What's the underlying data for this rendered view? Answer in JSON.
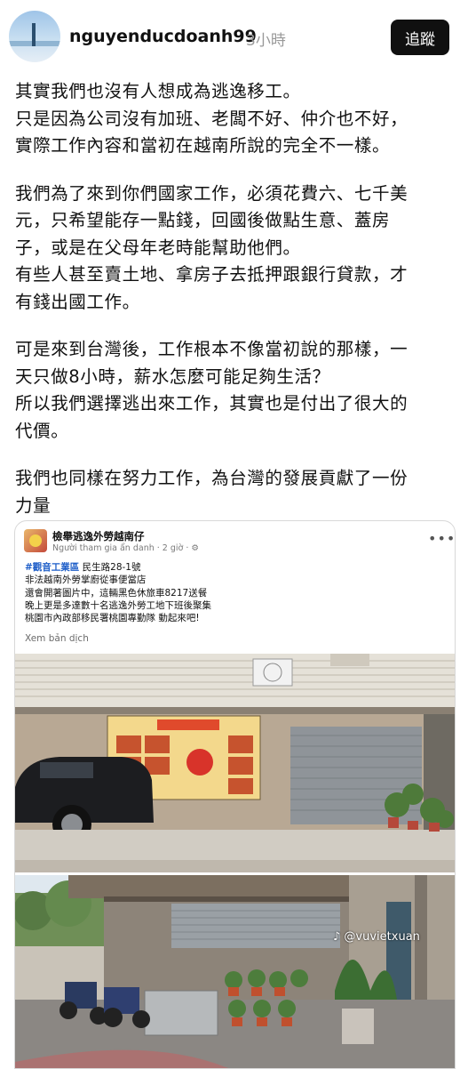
{
  "header": {
    "username": "nguyenducdoanh99",
    "time": "3小時",
    "follow_label": "追蹤"
  },
  "post": {
    "paragraphs": [
      [
        "其實我們也沒有人想成為逃逸移工。",
        "只是因為公司沒有加班、老闆不好、仲介也不好，",
        "實際工作內容和當初在越南所說的完全不一樣。"
      ],
      [
        "我們為了來到你們國家工作，必須花費六、七千美",
        "元，只希望能存一點錢，回國後做點生意、蓋房",
        "子，或是在父母年老時能幫助他們。",
        "有些人甚至賣土地、拿房子去抵押跟銀行貸款，才",
        "有錢出國工作。"
      ],
      [
        "可是來到台灣後，工作根本不像當初說的那樣，一",
        "天只做8小時，薪水怎麼可能足夠生活？",
        "所以我們選擇逃出來工作，其實也是付出了很大的",
        "代價。"
      ],
      [
        "我們也同樣在努力工作，為台灣的發展貢獻了一份",
        "力量"
      ]
    ]
  },
  "embed": {
    "group_name": "檢舉逃逸外勞越南仔",
    "meta": "Người tham gia ẩn danh · 2 giờ · ",
    "hashtag": "#觀音工業區",
    "address": " 民生路28-1號",
    "lines": [
      "非法越南外勞掌廚從事便當店",
      "還會開著圖片中，這輛黑色休旅車8217送餐",
      "晚上更是多達數十名逃逸外勞工地下班後聚集",
      "桃園市內政部移民署桃園專勤隊  動起來吧!"
    ],
    "translate_label": "Xem bản dịch",
    "watermark": "♪ @vuvietxuan"
  },
  "colors": {
    "follow_button_bg": "#101010",
    "hashtag": "#1e5ec8",
    "muted_text": "#999999"
  }
}
